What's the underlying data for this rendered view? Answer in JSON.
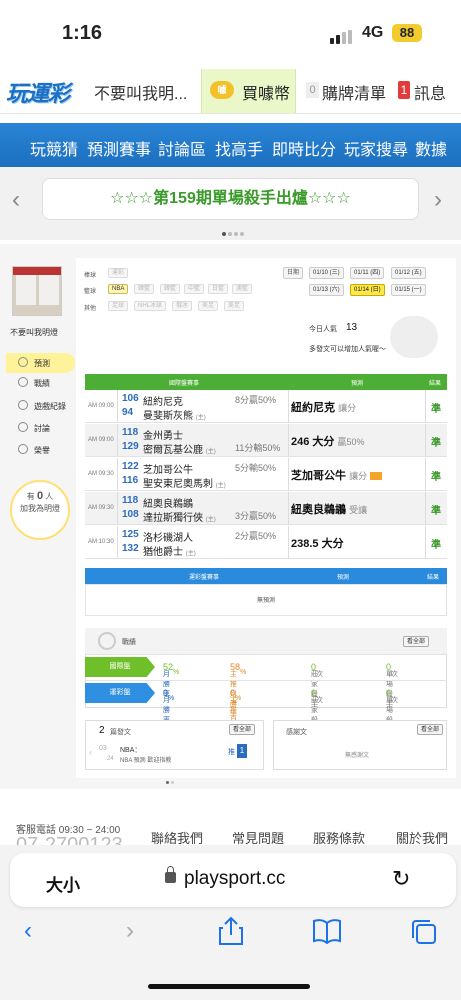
{
  "status_bar": {
    "time": "1:16",
    "network": "4G",
    "battery": "88"
  },
  "topnav": {
    "logo": "玩運彩",
    "username": "不要叫我明...",
    "buy_coin": "買噱幣",
    "coin_icon": "噱",
    "cart_count": "0",
    "cart_label": "購牌清單",
    "msg_count": "1",
    "msg_label": "訊息"
  },
  "menu": [
    "玩競猜",
    "預測賽事",
    "討論區",
    "找高手",
    "即時比分",
    "玩家搜尋",
    "數據"
  ],
  "banner": {
    "text": "☆☆☆第159期單場殺手出爐☆☆☆"
  },
  "sidebar": {
    "username": "不要叫我明燈",
    "items": [
      "預測",
      "戰績",
      "遊戲紀錄",
      "討論",
      "榮譽"
    ],
    "bulb_line1": "有",
    "bulb_count": "0",
    "bulb_unit": "人",
    "bulb_line2": "加我為明燈"
  },
  "filters": {
    "baseball_label": "棒球",
    "baseball": [
      "運彩"
    ],
    "basketball_label": "籃球",
    "basketball": [
      "NBA",
      "韓籃",
      "韓籃",
      "中籃",
      "日籃",
      "澳籃"
    ],
    "other_label": "其他",
    "other": [
      "足球",
      "NHL冰球",
      "俄冰",
      "美足",
      "美足"
    ],
    "date_label": "日期",
    "dates": [
      "01/10 (三)",
      "01/11 (四)",
      "01/12 (五)",
      "01/13 (六)",
      "01/14 (日)",
      "01/15 (一)"
    ],
    "active_date": "01/14 (日)",
    "visitors_label": "今日人氣",
    "visitors": "13",
    "post_hint": "多發文可以增加人氣喔～"
  },
  "table": {
    "headers": [
      "國際盤賽事",
      "預測",
      "結果"
    ],
    "rows": [
      {
        "time": "AM 09:00",
        "n1": "106",
        "t1": "紐約尼克",
        "n2": "94",
        "t2": "曼斐斯灰熊",
        "t2_tag": "(主)",
        "line": "8分贏50%",
        "line_row": 1,
        "pick": "紐約尼克",
        "pick_note": "讓分",
        "result": "準"
      },
      {
        "time": "AM 09:00",
        "n1": "118",
        "t1": "金州勇士",
        "n2": "129",
        "t2": "密爾瓦基公鹿",
        "t2_tag": "(主)",
        "line": "11分輸50%",
        "line_row": 2,
        "pick": "246 大分",
        "pick_note": "贏50%",
        "result": "準"
      },
      {
        "time": "AM 09:30",
        "n1": "122",
        "t1": "芝加哥公牛",
        "n2": "116",
        "t2": "聖安東尼奧馬刺",
        "t2_tag": "(主)",
        "line": "5分輸50%",
        "line_row": 1,
        "pick": "芝加哥公牛",
        "pick_note": "讓分",
        "result": "準"
      },
      {
        "time": "AM 09:30",
        "n1": "118",
        "t1": "紐奧良鵜鶘",
        "n2": "108",
        "t2": "達拉斯獨行俠",
        "t2_tag": "(主)",
        "line": "3分贏50%",
        "line_row": 2,
        "pick": "紐奧良鵜鶘",
        "pick_note": "受讓",
        "result": "準"
      },
      {
        "time": "AM 10:30",
        "n1": "125",
        "t1": "洛杉磯湖人",
        "n2": "132",
        "t2": "猶他爵士",
        "t2_tag": "(主)",
        "line": "2分贏50%",
        "line_row": 1,
        "pick": "238.5 大分",
        "pick_note": "",
        "result": "準"
      }
    ]
  },
  "table2": {
    "headers": [
      "運彩盤賽事",
      "預測",
      "結果"
    ],
    "empty": "無預測"
  },
  "stats": {
    "title": "戰績",
    "all_btn": "看全部",
    "rows": [
      {
        "tab": "國際盤",
        "color": "#6fbf2a",
        "month_label": "月勝率",
        "month": "52",
        "main_label": "主推月勝率",
        "main": "58",
        "banker_label": "莊家殺手",
        "banker": "0",
        "single_label": "單場殺手",
        "single": "0"
      },
      {
        "tab": "運彩盤",
        "color": "#2f8fe0",
        "month_label": "月勝率",
        "month": "0",
        "main_label": "主推月勝率",
        "main": "0",
        "banker_label": "莊家殺手",
        "banker": "0",
        "single_label": "單場殺手",
        "single": "0"
      }
    ],
    "unit_pct": "%",
    "unit_times": "次"
  },
  "posts": {
    "count": "2",
    "label": "篇發文",
    "all_btn": "看全部",
    "month": "03",
    "day": "24",
    "post_title": "NBA：",
    "post_sub": "NBA 預測 歡迎指教",
    "push": "推",
    "push_count": "1"
  },
  "thanks": {
    "label": "感謝文",
    "all_btn": "看全部",
    "empty": "無感謝文"
  },
  "footer": {
    "phone": "客服電話 09:30 ~ 24:00",
    "big": "07-2700123",
    "links": [
      "聯絡我們",
      "常見問題",
      "服務條款",
      "關於我們"
    ]
  },
  "safari": {
    "aa": "大小",
    "url": "playsport.cc"
  }
}
